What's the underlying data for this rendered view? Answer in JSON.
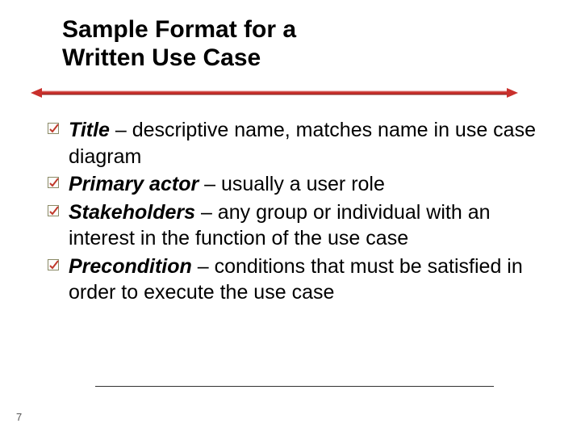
{
  "title_line1": "Sample Format for a",
  "title_line2": "Written Use Case",
  "items": [
    {
      "term": "Title",
      "desc": " – descriptive name, matches name in use case diagram"
    },
    {
      "term": "Primary actor",
      "desc": " – usually a user role"
    },
    {
      "term": "Stakeholders",
      "desc": " – any group or individual with an interest in the function of the use case"
    },
    {
      "term": "Precondition",
      "desc": " – conditions that must be satisfied in order to execute the use case"
    }
  ],
  "page_number": "7"
}
